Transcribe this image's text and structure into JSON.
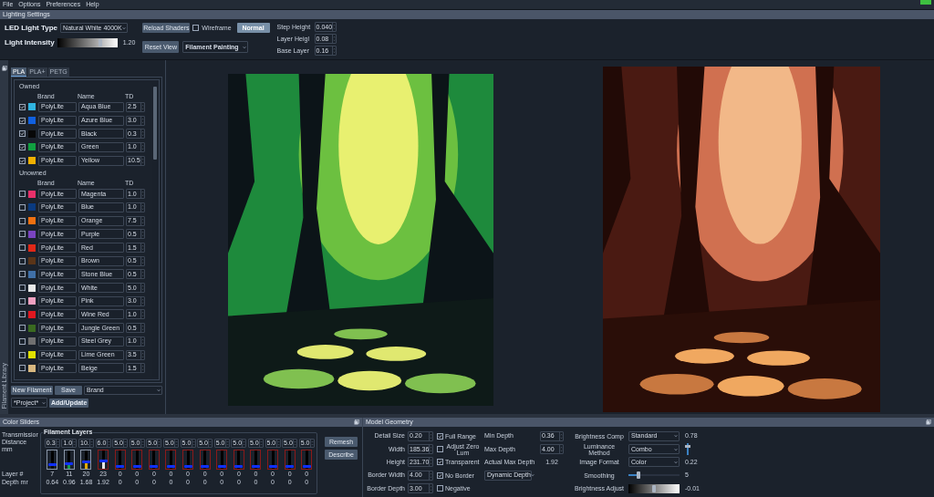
{
  "menu": [
    "File",
    "Options",
    "Preferences",
    "Help"
  ],
  "lighting_settings": {
    "title": "Lighting Settings",
    "led_light_type": {
      "label": "LED Light Type",
      "value": "Natural White 4000K"
    },
    "light_intensity": {
      "label": "Light Intensity",
      "level": 0.72,
      "reading": "1.20"
    },
    "reload_shaders": "Reload Shaders",
    "wireframe": {
      "label": "Wireframe",
      "checked": false
    },
    "normal": {
      "label": "Normal",
      "active": true
    },
    "reset_view": "Reset View",
    "paint_mode": "Filament Painting",
    "params": [
      {
        "label": "Step Height",
        "value": "0.040"
      },
      {
        "label": "Layer Heigl",
        "value": "0.08"
      },
      {
        "label": "Base Layer",
        "value": "0.16"
      }
    ]
  },
  "filament_library": {
    "side_tab": "Filament Library",
    "tabs": [
      {
        "label": "PLA",
        "selected": true
      },
      {
        "label": "PLA+",
        "selected": false
      },
      {
        "label": "PETG",
        "selected": false
      }
    ],
    "sections": [
      {
        "title": "Owned",
        "columns": [
          "Brand",
          "Name",
          "TD"
        ],
        "rows": [
          {
            "checked": true,
            "color": "#30b4e0",
            "brand": "PolyLite",
            "name": "Aqua Blue",
            "td": "2.5"
          },
          {
            "checked": true,
            "color": "#1060e0",
            "brand": "PolyLite",
            "name": "Azure Blue",
            "td": "3.0"
          },
          {
            "checked": true,
            "color": "#080808",
            "brand": "PolyLite",
            "name": "Black",
            "td": "0.3"
          },
          {
            "checked": true,
            "color": "#10a040",
            "brand": "PolyLite",
            "name": "Green",
            "td": "1.0"
          },
          {
            "checked": true,
            "color": "#f0b000",
            "brand": "PolyLite",
            "name": "Yellow",
            "td": "10.5"
          }
        ]
      },
      {
        "title": "Unowned",
        "columns": [
          "Brand",
          "Name",
          "TD"
        ],
        "rows": [
          {
            "checked": false,
            "color": "#e8306a",
            "brand": "PolyLite",
            "name": "Magenta",
            "td": "1.0"
          },
          {
            "checked": false,
            "color": "#0a3a80",
            "brand": "PolyLite",
            "name": "Blue",
            "td": "1.0"
          },
          {
            "checked": false,
            "color": "#f07010",
            "brand": "PolyLite",
            "name": "Orange",
            "td": "7.5"
          },
          {
            "checked": false,
            "color": "#7a44c0",
            "brand": "PolyLite",
            "name": "Purple",
            "td": "0.5"
          },
          {
            "checked": false,
            "color": "#e02818",
            "brand": "PolyLite",
            "name": "Red",
            "td": "1.5"
          },
          {
            "checked": false,
            "color": "#5a3418",
            "brand": "PolyLite",
            "name": "Brown",
            "td": "0.5"
          },
          {
            "checked": false,
            "color": "#4070a8",
            "brand": "PolyLite",
            "name": "Stone Blue",
            "td": "0.5"
          },
          {
            "checked": false,
            "color": "#e8e8e8",
            "brand": "PolyLite",
            "name": "White",
            "td": "5.0"
          },
          {
            "checked": false,
            "color": "#f0a0c0",
            "brand": "PolyLite",
            "name": "Pink",
            "td": "3.0"
          },
          {
            "checked": false,
            "color": "#e01820",
            "brand": "PolyLite",
            "name": "Wine Red",
            "td": "1.0"
          },
          {
            "checked": false,
            "color": "#3a6a20",
            "brand": "PolyLite",
            "name": "Jungle Green",
            "td": "0.5"
          },
          {
            "checked": false,
            "color": "#707070",
            "brand": "PolyLite",
            "name": "Steel Grey",
            "td": "1.0"
          },
          {
            "checked": false,
            "color": "#e0e000",
            "brand": "PolyLite",
            "name": "Lime Green",
            "td": "3.5"
          },
          {
            "checked": false,
            "color": "#d8b880",
            "brand": "PolyLite",
            "name": "Beige",
            "td": "1.5"
          }
        ]
      }
    ],
    "new_filament": "New Filament",
    "save": "Save",
    "brand_select": "Brand",
    "project_select": "*Project*",
    "add_update": "Add/Update"
  },
  "color_sliders": {
    "title": "Color Sliders",
    "group_title": "Filament Layers",
    "transmission_label": [
      "Transmissior",
      "Distance",
      "mm"
    ],
    "layer_label": "Layer #",
    "depth_label": "Depth mr",
    "layers": [
      {
        "td": "0.3",
        "level": 0.15,
        "color": "#0a0a0a",
        "warning": false,
        "layer": "7",
        "depth": "0.64"
      },
      {
        "td": "1.0",
        "level": 0.2,
        "color": "#1a9a50",
        "warning": false,
        "layer": "11",
        "depth": "0.96"
      },
      {
        "td": "10.",
        "level": 0.3,
        "color": "#e0a800",
        "warning": false,
        "layer": "20",
        "depth": "1.68"
      },
      {
        "td": "6.0",
        "level": 0.35,
        "color": "#e8e8e8",
        "warning": true,
        "layer": "23",
        "depth": "1.92"
      },
      {
        "td": "5.0",
        "level": 0,
        "warning": true,
        "layer": "0",
        "depth": "0"
      },
      {
        "td": "5.0",
        "level": 0,
        "warning": true,
        "layer": "0",
        "depth": "0"
      },
      {
        "td": "5.0",
        "level": 0,
        "warning": true,
        "layer": "0",
        "depth": "0"
      },
      {
        "td": "5.0",
        "level": 0,
        "warning": true,
        "layer": "0",
        "depth": "0"
      },
      {
        "td": "5.0",
        "level": 0,
        "warning": true,
        "layer": "0",
        "depth": "0"
      },
      {
        "td": "5.0",
        "level": 0,
        "warning": true,
        "layer": "0",
        "depth": "0"
      },
      {
        "td": "5.0",
        "level": 0,
        "warning": true,
        "layer": "0",
        "depth": "0"
      },
      {
        "td": "5.0",
        "level": 0,
        "warning": true,
        "layer": "0",
        "depth": "0"
      },
      {
        "td": "5.0",
        "level": 0,
        "warning": true,
        "layer": "0",
        "depth": "0"
      },
      {
        "td": "5.0",
        "level": 0,
        "warning": true,
        "layer": "0",
        "depth": "0"
      },
      {
        "td": "5.0",
        "level": 0,
        "warning": true,
        "layer": "0",
        "depth": "0"
      },
      {
        "td": "5.0",
        "level": 0,
        "warning": true,
        "layer": "0",
        "depth": "0"
      }
    ],
    "buttons": [
      "Remesh",
      "Describe"
    ]
  },
  "model_geometry": {
    "title": "Model Geometry",
    "fields": [
      {
        "label": "Detail Size",
        "value": "0.20"
      },
      {
        "label": "Width",
        "value": "185.36"
      },
      {
        "label": "Height",
        "value": "231.70"
      },
      {
        "label": "Border Width",
        "value": "4.00"
      },
      {
        "label": "Border Depth",
        "value": "3.00"
      }
    ],
    "options": [
      {
        "label": "Full Range",
        "checked": true
      },
      {
        "label": "Adjust Zero Lum",
        "checked": false
      },
      {
        "label": "Transparent",
        "checked": true
      },
      {
        "label": "No Border",
        "checked": true
      },
      {
        "label": "Negative",
        "checked": false
      }
    ],
    "depth": [
      {
        "kind": "spin",
        "label": "Min Depth",
        "value": "0.36"
      },
      {
        "kind": "spin",
        "label": "Max Depth",
        "value": "4.00"
      },
      {
        "kind": "readout",
        "label": "Actual Max Depth",
        "value": "1.92"
      },
      {
        "kind": "select",
        "value": "Dynamic Depth"
      }
    ],
    "image": [
      {
        "kind": "select",
        "label": "Brightness Comp",
        "value": "Standard",
        "reading": "0.78"
      },
      {
        "kind": "select_vslider",
        "label": "Luminance Method",
        "value": "Combo",
        "level": 0.8
      },
      {
        "kind": "select",
        "label": "Image Format",
        "value": "Color",
        "reading": "0.22"
      },
      {
        "kind": "slider",
        "label": "Smoothing",
        "level": 0.2,
        "reading": "5"
      },
      {
        "kind": "gradient_slider",
        "label": "Brightness Adjust",
        "level": 0.5,
        "reading": "-0.01"
      }
    ]
  }
}
